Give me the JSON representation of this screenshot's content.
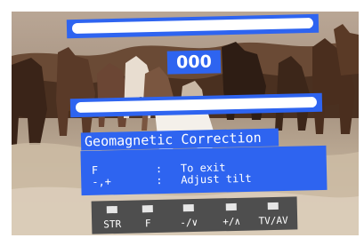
{
  "osd": {
    "value": "000",
    "title": "Geomagnetic Correction",
    "help": [
      {
        "key": "F",
        "sep": ":",
        "desc": "To exit"
      },
      {
        "key": "-,+",
        "sep": ":",
        "desc": "Adjust tilt"
      }
    ],
    "keys": [
      "STR",
      "F",
      "-/∨",
      "+/∧",
      "TV/AV"
    ],
    "slider_level": 1.0
  },
  "colors": {
    "panel": "#2e64f0",
    "track": "#ffffff",
    "keybar": "#4e4e4e",
    "text": "#ffffff"
  }
}
